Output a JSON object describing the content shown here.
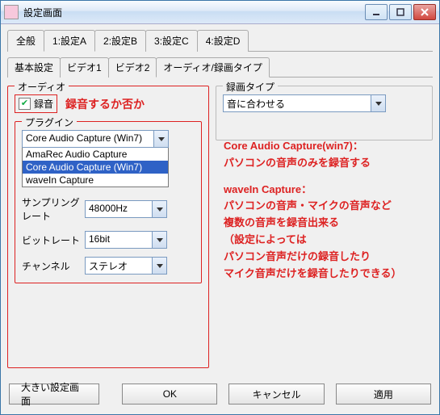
{
  "window": {
    "title": "設定画面"
  },
  "tabs_main": {
    "items": [
      "全般",
      "1:設定A",
      "2:設定B",
      "3:設定C",
      "4:設定D"
    ],
    "active": 1
  },
  "tabs_sub": {
    "items": [
      "基本設定",
      "ビデオ1",
      "ビデオ2",
      "オーディオ/録画タイプ"
    ],
    "active": 3
  },
  "audio": {
    "legend": "オーディオ",
    "record_label": "録音",
    "note_record": "録音するか否か",
    "plugin_legend": "プラグイン",
    "plugin_selected": "Core Audio Capture (Win7)",
    "plugin_options": [
      "AmaRec Audio Capture",
      "Core Audio Capture (Win7)",
      "waveIn Capture"
    ],
    "sample_label": "サンプリングレート",
    "sample_value": "48000Hz",
    "bit_label": "ビットレート",
    "bit_value": "16bit",
    "channel_label": "チャンネル",
    "channel_value": "ステレオ"
  },
  "rectype": {
    "legend": "録画タイプ",
    "value": "音に合わせる"
  },
  "notes": {
    "l1": "Core Audio Capture(win7)：",
    "l2": "パソコンの音声のみを録音する",
    "l3": "waveIn Capture：",
    "l4": "パソコンの音声・マイクの音声など",
    "l5": "複数の音声を録音出来る",
    "l6": "（設定によっては",
    "l7": "パソコン音声だけの録音したり",
    "l8": "マイク音声だけを録音したりできる）"
  },
  "footer": {
    "big": "大きい設定画面",
    "ok": "OK",
    "cancel": "キャンセル",
    "apply": "適用"
  }
}
